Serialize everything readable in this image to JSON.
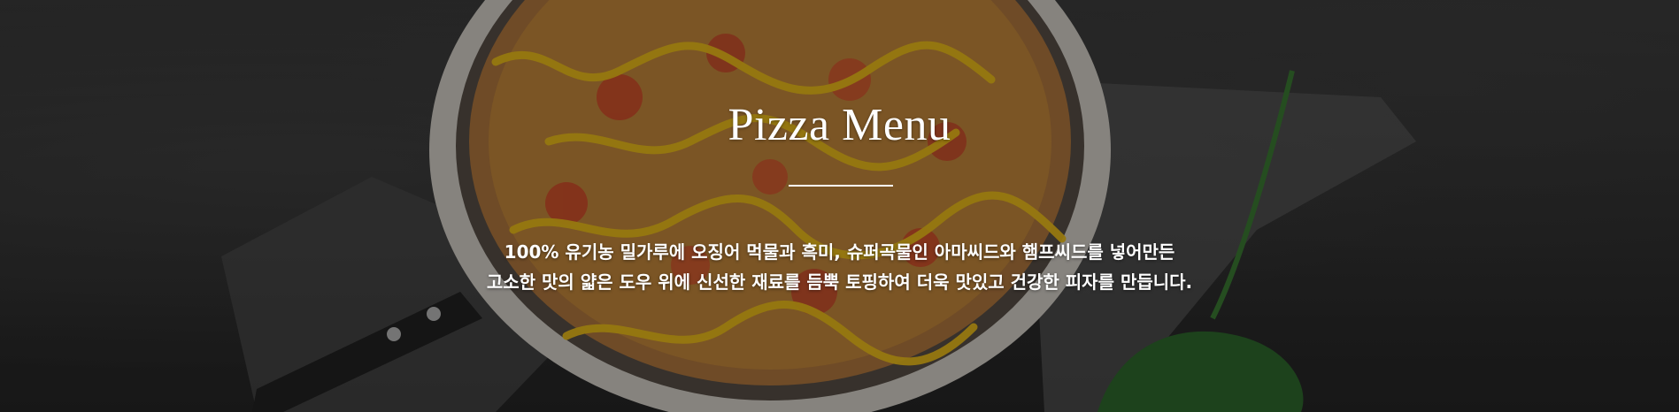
{
  "hero": {
    "title": "Pizza Menu",
    "description_lines": [
      "100% 유기농 밀가루에 오징어 먹물과 흑미, 슈퍼곡물인 아마씨드와 햄프씨드를 넣어만든",
      "고소한 맛의 얇은 도우 위에 신선한 재료를 듬뿍 토핑하여 더욱 맛있고 건강한 피자를 만듭니다."
    ]
  }
}
